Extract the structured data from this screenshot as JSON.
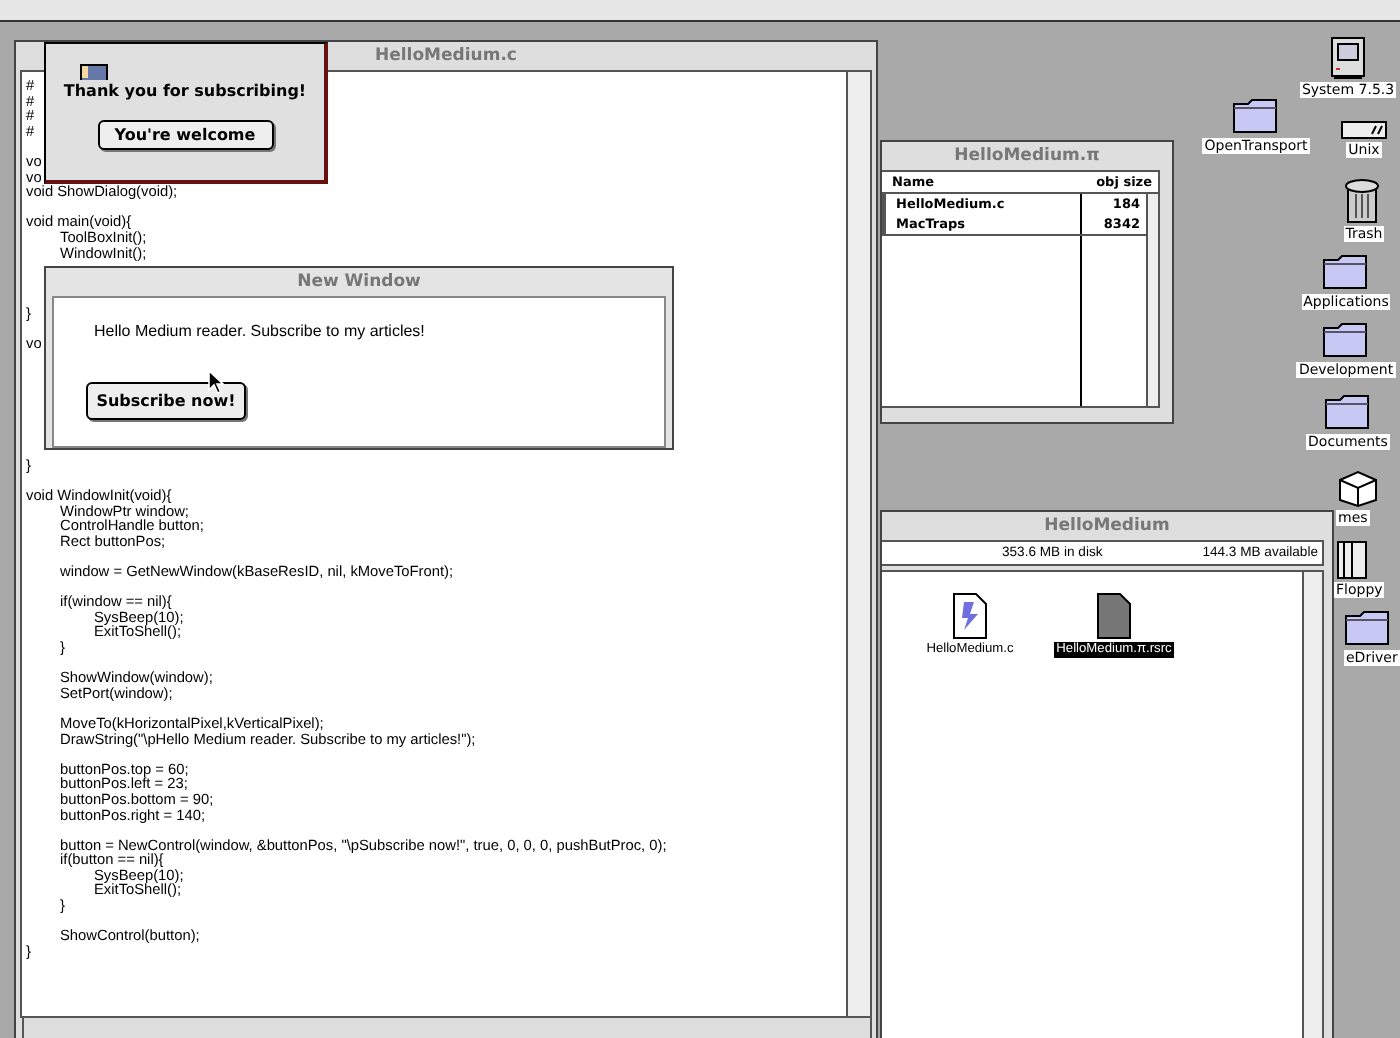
{
  "code_window": {
    "title": "HelloMedium.c",
    "lines": [
      {
        "kind": "code",
        "text": "#"
      },
      {
        "kind": "code",
        "text": "#"
      },
      {
        "kind": "code",
        "text": "#"
      },
      {
        "kind": "code",
        "text": "#"
      },
      {
        "kind": "blank"
      },
      {
        "kind": "code",
        "text": "vo"
      },
      {
        "kind": "code",
        "text": "vo"
      },
      {
        "kind": "code",
        "text": "void ShowDialog(void);"
      },
      {
        "kind": "blank"
      },
      {
        "kind": "code",
        "text": "void main(void){"
      },
      {
        "kind": "code",
        "text": "\tToolBoxInit();"
      },
      {
        "kind": "code",
        "text": "\tWindowInit();"
      },
      {
        "kind": "blank"
      },
      {
        "kind": "blank"
      },
      {
        "kind": "blank"
      },
      {
        "kind": "code",
        "text": "}"
      },
      {
        "kind": "blank"
      },
      {
        "kind": "code",
        "text": "vo"
      },
      {
        "kind": "blank"
      },
      {
        "kind": "blank"
      },
      {
        "kind": "blank"
      },
      {
        "kind": "blank"
      },
      {
        "kind": "blank"
      },
      {
        "kind": "blank"
      },
      {
        "kind": "blank"
      },
      {
        "kind": "code",
        "text": "}"
      },
      {
        "kind": "blank"
      },
      {
        "kind": "code",
        "text": "void WindowInit(void){"
      },
      {
        "kind": "code",
        "text": "\tWindowPtr window;"
      },
      {
        "kind": "code",
        "text": "\tControlHandle button;"
      },
      {
        "kind": "code",
        "text": "\tRect buttonPos;"
      },
      {
        "kind": "blank"
      },
      {
        "kind": "code",
        "text": "\twindow = GetNewWindow(kBaseResID, nil, kMoveToFront);"
      },
      {
        "kind": "blank"
      },
      {
        "kind": "code",
        "text": "\tif(window == nil){"
      },
      {
        "kind": "code",
        "text": "\t\tSysBeep(10);"
      },
      {
        "kind": "code",
        "text": "\t\tExitToShell();"
      },
      {
        "kind": "code",
        "text": "\t}"
      },
      {
        "kind": "blank"
      },
      {
        "kind": "code",
        "text": "\tShowWindow(window);"
      },
      {
        "kind": "code",
        "text": "\tSetPort(window);"
      },
      {
        "kind": "blank"
      },
      {
        "kind": "code",
        "text": "\tMoveTo(kHorizontalPixel,kVerticalPixel);"
      },
      {
        "kind": "code",
        "text": "\tDrawString(\"\\pHello Medium reader. Subscribe to my articles!\");"
      },
      {
        "kind": "blank"
      },
      {
        "kind": "code",
        "text": "\tbuttonPos.top = 60;"
      },
      {
        "kind": "code",
        "text": "\tbuttonPos.left = 23;"
      },
      {
        "kind": "code",
        "text": "\tbuttonPos.bottom = 90;"
      },
      {
        "kind": "code",
        "text": "\tbuttonPos.right = 140;"
      },
      {
        "kind": "blank"
      },
      {
        "kind": "code",
        "text": "\tbutton = NewControl(window, &buttonPos, \"\\pSubscribe now!\", true, 0, 0, 0, pushButProc, 0);"
      },
      {
        "kind": "code",
        "text": "\tif(button == nil){"
      },
      {
        "kind": "code",
        "text": "\t\tSysBeep(10);"
      },
      {
        "kind": "code",
        "text": "\t\tExitToShell();"
      },
      {
        "kind": "code",
        "text": "\t}"
      },
      {
        "kind": "blank"
      },
      {
        "kind": "code",
        "text": "\tShowControl(button);"
      },
      {
        "kind": "code",
        "text": "}"
      }
    ]
  },
  "alert": {
    "message": "Thank you for subscribing!",
    "button": "You're welcome"
  },
  "new_window": {
    "title": "New Window",
    "text": "Hello Medium reader. Subscribe to my articles!",
    "button": "Subscribe now!"
  },
  "project_window": {
    "title": "HelloMedium.π",
    "columns": [
      "Name",
      "obj size"
    ],
    "rows": [
      {
        "name": "HelloMedium.c",
        "size": "184"
      },
      {
        "name": "MacTraps",
        "size": "8342"
      }
    ]
  },
  "finder_window": {
    "title": "HelloMedium",
    "disk": "353.6 MB in disk",
    "available": "144.3 MB available",
    "files": [
      {
        "name": "HelloMedium.c",
        "kind": "source",
        "selected": false
      },
      {
        "name": "HelloMedium.π.rsrc",
        "kind": "document",
        "selected": true
      }
    ]
  },
  "desktop_icons": [
    {
      "label": "System 7.5.3",
      "kind": "computer"
    },
    {
      "label": "OpenTransport",
      "kind": "folder"
    },
    {
      "label": "Unix",
      "kind": "drive"
    },
    {
      "label": "Trash",
      "kind": "trash"
    },
    {
      "label": "Applications",
      "kind": "folder"
    },
    {
      "label": "Development",
      "kind": "folder"
    },
    {
      "label": "Documents",
      "kind": "folder"
    },
    {
      "label": "mes",
      "kind": "box"
    },
    {
      "label": "Floppy",
      "kind": "floppy"
    },
    {
      "label": "eDriver",
      "kind": "folder"
    }
  ]
}
